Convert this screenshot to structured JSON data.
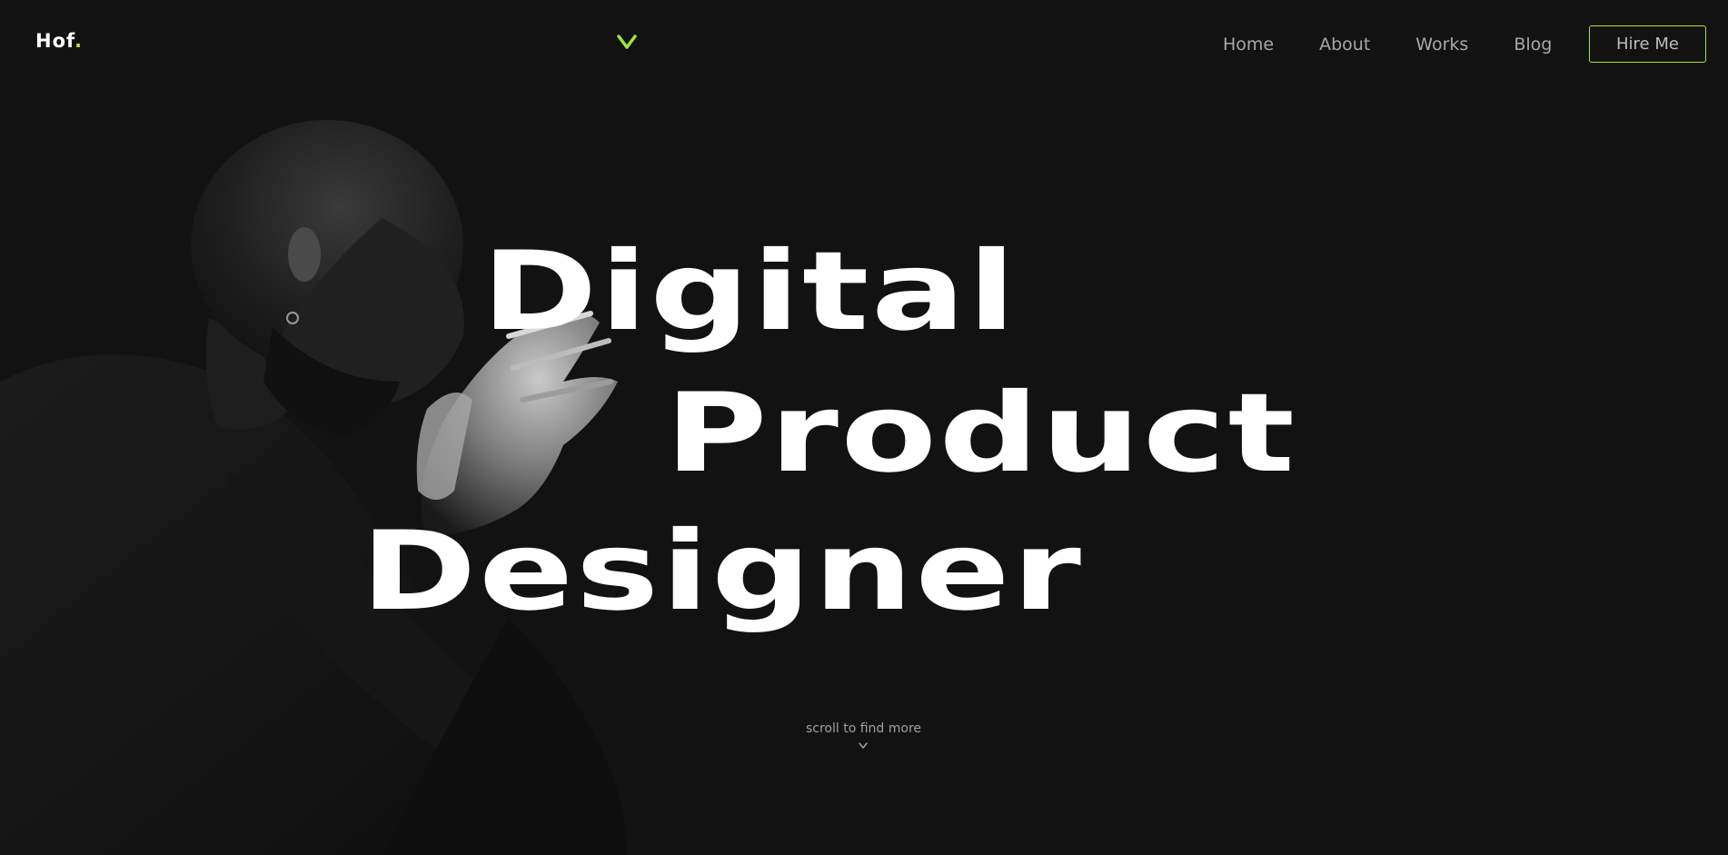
{
  "header": {
    "logo_text": "Hof",
    "logo_dot": ".",
    "center_icon": "v-chevron-icon",
    "nav": [
      {
        "label": "Home"
      },
      {
        "label": "About"
      },
      {
        "label": "Works"
      },
      {
        "label": "Blog"
      }
    ],
    "cta_label": "Hire Me"
  },
  "hero": {
    "line_1": "Digital",
    "line_2": "Product",
    "line_3": "Designer",
    "portrait_icon": "portrait-photo"
  },
  "scroll": {
    "text": "scroll to find more",
    "icon": "chevron-down-icon"
  },
  "colors": {
    "background": "#121212",
    "accent": "#a3e635",
    "text": "#ffffff",
    "muted": "#a8a8a8"
  }
}
